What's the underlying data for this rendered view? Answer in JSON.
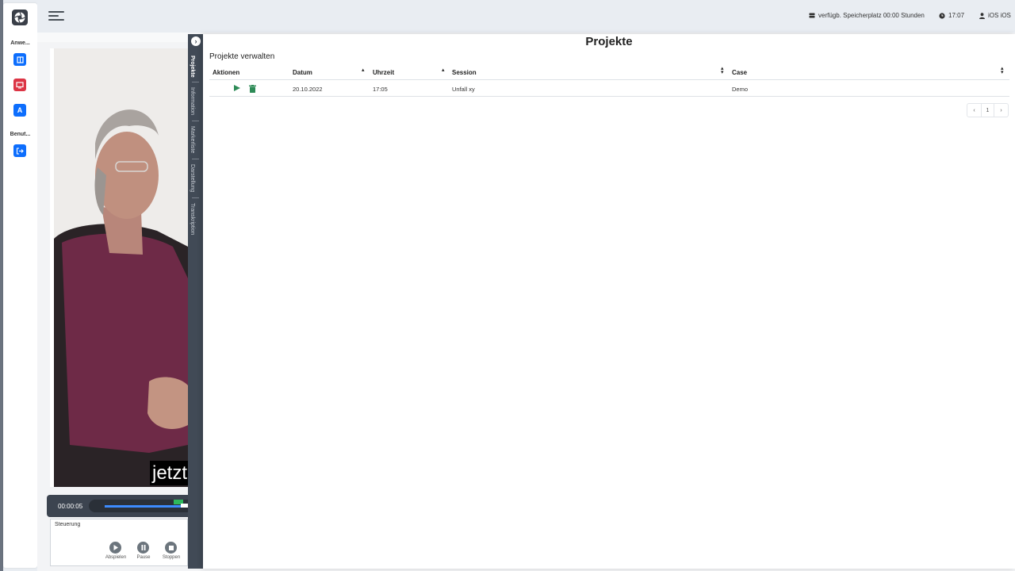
{
  "sidebar": {
    "logo_icon": "aperture-icon",
    "sections": [
      {
        "label": "Anwe...",
        "items": [
          {
            "icon": "book-icon",
            "color": "#0d6efd"
          },
          {
            "icon": "monitor-icon",
            "color": "#dc3545"
          },
          {
            "icon": "text-a-icon",
            "label": "A",
            "color": "#0d6efd"
          }
        ]
      },
      {
        "label": "Benut...",
        "items": [
          {
            "icon": "logout-icon",
            "color": "#0d6efd"
          }
        ]
      }
    ]
  },
  "topbar": {
    "menu_icon": "hamburger-menu-icon",
    "storage_text": "verfügb. Speicherplatz 00:00 Stunden",
    "time": "17:07",
    "user": "iOS iOS"
  },
  "player": {
    "subtitle": "jetzt",
    "timecode": "00:00:05",
    "controls_title": "Steuerung",
    "play_label": "Abspielen",
    "pause_label": "Pause",
    "stop_label": "Stoppen"
  },
  "rail": {
    "tabs": [
      "Projekte",
      "Information",
      "Markerliste",
      "Darstellung",
      "Transkription"
    ],
    "active": "Projekte"
  },
  "panel": {
    "title": "Projekte",
    "subtitle": "Projekte verwalten",
    "columns": [
      "Aktionen",
      "Datum",
      "Uhrzeit",
      "Session",
      "Case"
    ],
    "rows": [
      {
        "datum": "20.10.2022",
        "uhrzeit": "17:05",
        "session": "Unfall xy",
        "case": "Demo"
      }
    ],
    "pagination": {
      "current_page": "1"
    }
  },
  "colors": {
    "primary": "#0d6efd",
    "danger": "#dc3545",
    "action_green": "#2e8b57",
    "rail": "#414a56"
  }
}
